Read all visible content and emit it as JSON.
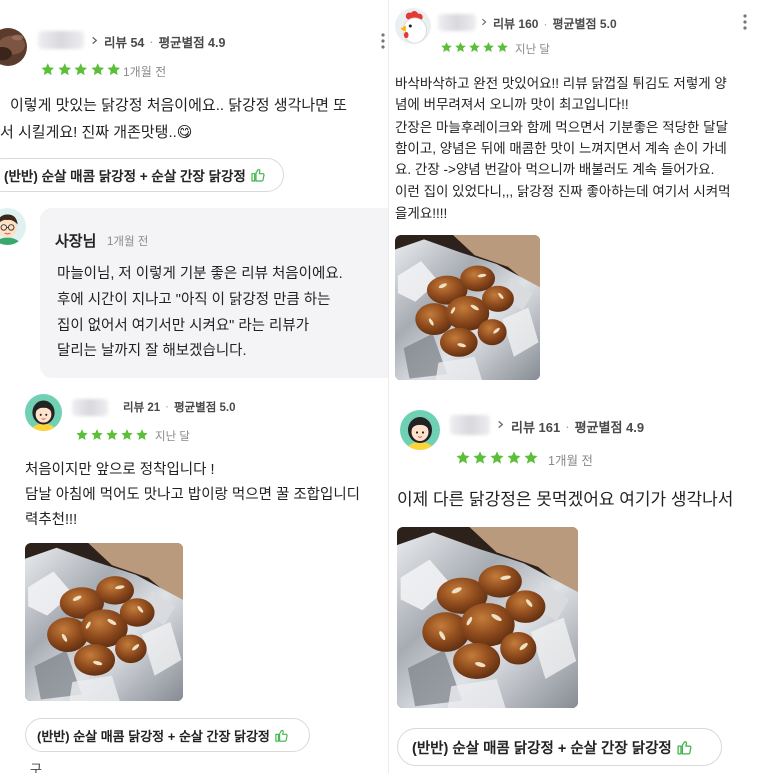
{
  "app": {
    "star_color": "#5cbf3a",
    "accent_color": "#3fb44b"
  },
  "icons": {
    "chevron": "chevron-right-icon",
    "menu": "more-vertical-icon",
    "star": "star-icon",
    "thumb": "thumbs-up-icon"
  },
  "reviews": [
    {
      "stats": {
        "review_count": "리뷰 54",
        "separator": "·",
        "avg_rating": "평균별점 4.9"
      },
      "rating": 5,
      "time_ago": "1개월 전",
      "lines": [
        "이렇게 맛있는 닭강정 처음이에요.. 닭강정 생각나면 또",
        "서 시킬게요! 진짜 개존맛탱..😋"
      ],
      "menu_chip": {
        "label": "(반반) 순살 매콤 닭강정 + 순살 간장 닭강정"
      },
      "owner_reply": {
        "author": "사장님",
        "time_ago": "1개월 전",
        "lines": [
          "마늘이님, 저 이렇게 기분 좋은 리뷰 처음이에요.",
          "후에 시간이 지나고 \"아직 이 닭강정 만큼 하는",
          "집이 없어서 여기서만 시켜요\" 라는 리뷰가",
          "달리는 날까지 잘 해보겠습니다."
        ]
      }
    },
    {
      "stats": {
        "review_count": "리뷰 160",
        "separator": "·",
        "avg_rating": "평균별점 5.0"
      },
      "rating": 5,
      "time_ago": "지난 달",
      "lines": [
        "바삭바삭하고 완전 맛있어요!! 리뷰 닭껍질 튀김도 저렇게 양",
        "념에 버무려져서 오니까 맛이 최고입니다!!",
        "간장은 마늘후레이크와 함께 먹으면서 기분좋은 적당한 달달",
        "함이고, 양념은 뒤에 매콤한 맛이 느껴지면서 계속 손이 가네",
        "요. 간장 ->양념 번갈아 먹으니까 배불러도 계속 들어가요.",
        "이런 집이 있었다니,,, 닭강정 진짜 좋아하는데 여기서 시켜먹",
        "을게요!!!!"
      ]
    },
    {
      "stats": {
        "review_count": "리뷰 21",
        "separator": "·",
        "avg_rating": "평균별점 5.0"
      },
      "rating": 5,
      "time_ago": "지난 달",
      "lines": [
        "처음이지만 앞으로 정착입니다 !",
        "담날 아침에 먹어도 맛나고 밥이랑 먹으면 꿀 조합입니디",
        "력추천!!!"
      ],
      "menu_chip": {
        "label": "(반반) 순살 매콤 닭강정 + 순살 간장 닭강정"
      },
      "next_review_fragment": "구"
    },
    {
      "stats": {
        "review_count": "리뷰 161",
        "separator": "·",
        "avg_rating": "평균별점 4.9"
      },
      "rating": 5,
      "time_ago": "1개월 전",
      "lines": [
        "이제 다른 닭강정은 못먹겠어요 여기가 생각나서"
      ],
      "menu_chip": {
        "label": "(반반) 순살 매콤 닭강정 + 순살 간장 닭강정"
      }
    }
  ]
}
